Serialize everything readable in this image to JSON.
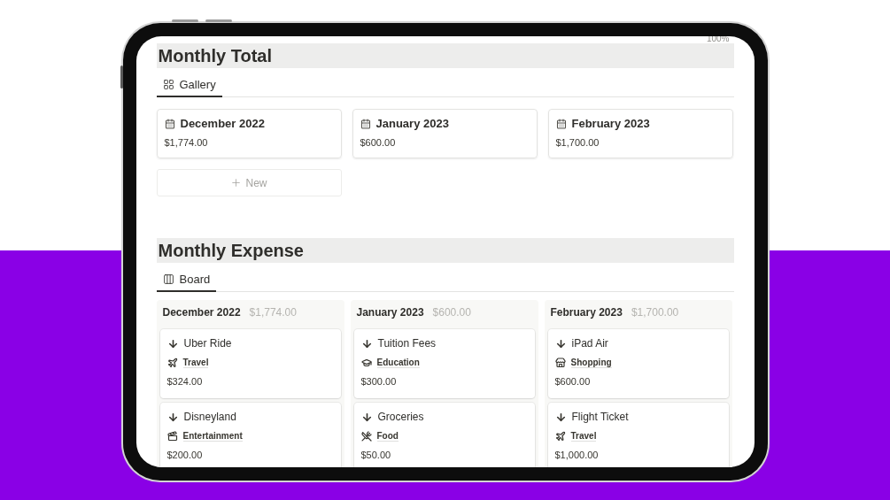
{
  "zoom_text": "100%",
  "sections": [
    {
      "title": "Monthly Total",
      "tabs": [
        {
          "label": "Gallery",
          "kind": "gallery",
          "selected": true
        }
      ],
      "cards": [
        {
          "title": "December 2022",
          "amount": "$1,774.00"
        },
        {
          "title": "January 2023",
          "amount": "$600.00"
        },
        {
          "title": "February 2023",
          "amount": "$1,700.00"
        }
      ],
      "new_button": "New"
    },
    {
      "title": "Monthly Expense",
      "tabs": [
        {
          "label": "Board",
          "kind": "board",
          "selected": true
        }
      ],
      "columns": [
        {
          "title": "December 2022",
          "total": "$1,774.00",
          "cards": [
            {
              "title": "Uber Ride",
              "kind": "travel",
              "category": "Travel",
              "amount": "$324.00"
            },
            {
              "title": "Disneyland",
              "kind": "entertainment",
              "category": "Entertainment",
              "amount": "$200.00"
            }
          ]
        },
        {
          "title": "January 2023",
          "total": "$600.00",
          "cards": [
            {
              "title": "Tuition Fees",
              "kind": "education",
              "category": "Education",
              "amount": "$300.00"
            },
            {
              "title": "Groceries",
              "kind": "food",
              "category": "Food",
              "amount": "$50.00"
            }
          ]
        },
        {
          "title": "February 2023",
          "total": "$1,700.00",
          "cards": [
            {
              "title": "iPad Air",
              "kind": "shopping",
              "category": "Shopping",
              "amount": "$600.00"
            },
            {
              "title": "Flight Ticket",
              "kind": "travel",
              "category": "Travel",
              "amount": "$1,000.00"
            }
          ]
        }
      ]
    }
  ]
}
